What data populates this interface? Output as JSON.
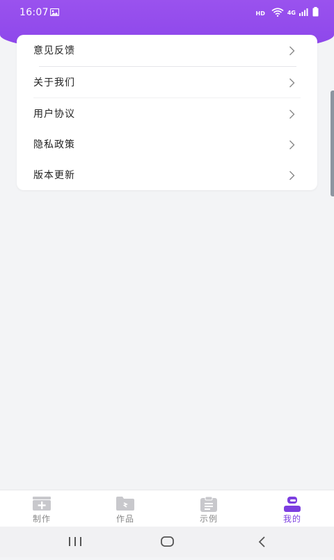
{
  "status_bar": {
    "time": "16:07",
    "hd": "HD",
    "network": "4G"
  },
  "menu": {
    "items": [
      {
        "label": "意见反馈"
      },
      {
        "label": "关于我们"
      },
      {
        "label": "用户协议"
      },
      {
        "label": "隐私政策"
      },
      {
        "label": "版本更新"
      }
    ]
  },
  "tabs": [
    {
      "label": "制作",
      "icon": "add-box-icon"
    },
    {
      "label": "作品",
      "icon": "folder-icon"
    },
    {
      "label": "示例",
      "icon": "clipboard-icon"
    },
    {
      "label": "我的",
      "icon": "user-icon"
    }
  ],
  "colors": {
    "accent": "#8b45ea",
    "active_tab": "#7c3ee0",
    "inactive_tab": "#888888"
  }
}
